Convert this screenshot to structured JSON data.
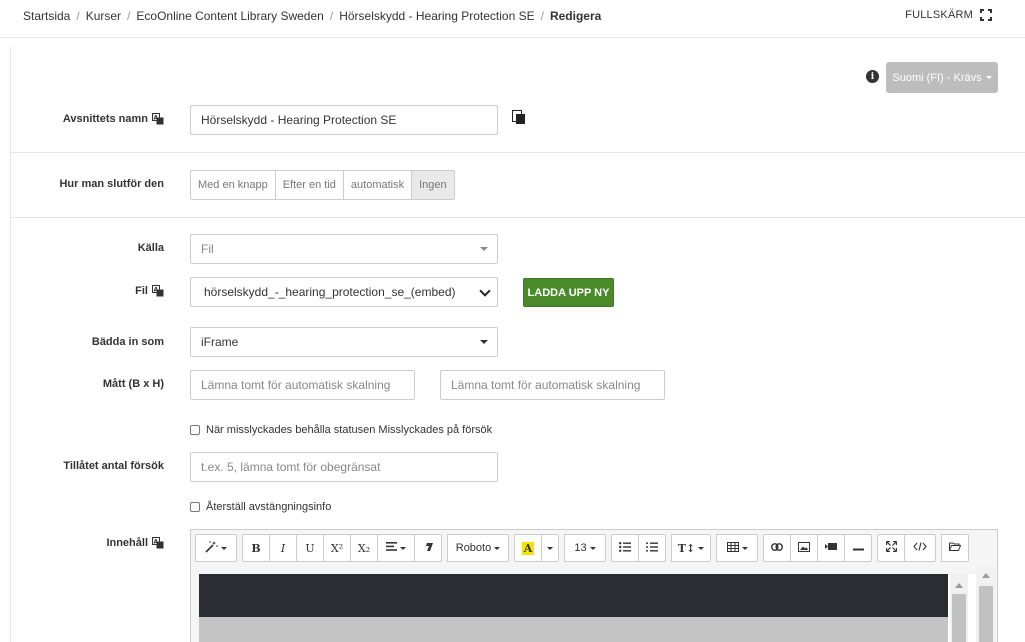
{
  "breadcrumb": {
    "items": [
      "Startsida",
      "Kurser",
      "EcoOnline Content Library Sweden",
      "Hörselskydd - Hearing Protection SE"
    ],
    "current": "Redigera",
    "separator": "/"
  },
  "header": {
    "fullscreen_label": "FULLSKÄRM"
  },
  "language": {
    "button_label": "Suomi (FI) - Krävs",
    "info_icon": "i"
  },
  "fields": {
    "section_name": {
      "label": "Avsnittets namn",
      "value": "Hörselskydd - Hearing Protection SE"
    },
    "completion": {
      "label": "Hur man slutför den",
      "options": [
        "Med en knapp",
        "Efter en tid",
        "automatisk",
        "Ingen"
      ],
      "selected": "Ingen"
    },
    "source": {
      "label": "Källa",
      "value": "Fil"
    },
    "file": {
      "label": "Fil",
      "value": "hörselskydd_-_hearing_protection_se_(embed)",
      "upload_label": "LADDA UPP NY"
    },
    "embed": {
      "label": "Bädda in som",
      "value": "iFrame"
    },
    "dimensions": {
      "label": "Mått (B x H)",
      "width_placeholder": "Lämna tomt för automatisk skalning",
      "height_placeholder": "Lämna tomt för automatisk skalning"
    },
    "keep_failed": {
      "label": "När misslyckades behålla statusen Misslyckades på försök",
      "checked": false
    },
    "attempts": {
      "label": "Tillåtet antal försök",
      "placeholder": "t.ex. 5, lämna tomt för obegränsat"
    },
    "reset_shutdown": {
      "label": "Återställ avstängningsinfo",
      "checked": false
    },
    "content": {
      "label": "Innehåll"
    }
  },
  "editor": {
    "font_family": "Roboto",
    "font_size": "13",
    "bold": "B",
    "italic": "I",
    "underline": "U",
    "superscript": "X²",
    "subscript": "X₂",
    "text_color": "A",
    "text_transform": "T↕",
    "icons": [
      "magic-wand-icon",
      "align-icon",
      "eraser-icon",
      "bullet-list-icon",
      "numbered-list-icon",
      "table-icon",
      "link-icon",
      "image-icon",
      "video-icon",
      "hr-icon",
      "fullscreen-icon",
      "code-view-icon",
      "folder-icon"
    ],
    "highlight_color": "#f5e400"
  },
  "colors": {
    "upload_button": "#4a8a2a",
    "language_button": "#bdbdbd",
    "editor_dark_band": "#2a2e34"
  }
}
